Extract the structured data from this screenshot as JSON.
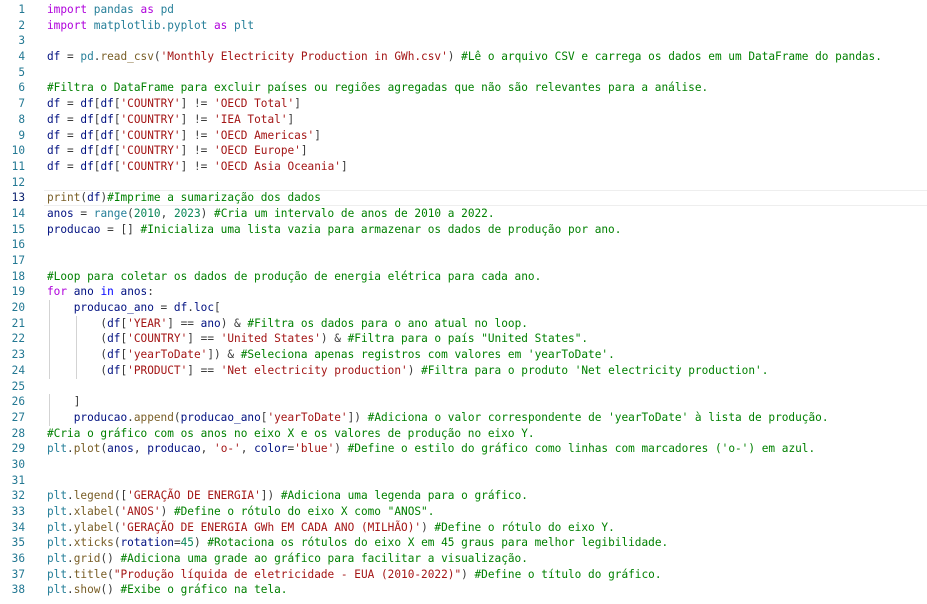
{
  "editor": {
    "language": "python",
    "current_line": 13,
    "colors": {
      "keyword": "#0000ff",
      "control": "#af00db",
      "function": "#795e26",
      "variable": "#001080",
      "string": "#a31515",
      "number": "#098658",
      "comment": "#008000",
      "line_number": "#237893"
    },
    "lines": [
      {
        "n": "1",
        "tokens": [
          [
            "ctl",
            "import"
          ],
          [
            "txt",
            " "
          ],
          [
            "mod",
            "pandas"
          ],
          [
            "txt",
            " "
          ],
          [
            "ctl",
            "as"
          ],
          [
            "txt",
            " "
          ],
          [
            "mod",
            "pd"
          ]
        ]
      },
      {
        "n": "2",
        "tokens": [
          [
            "ctl",
            "import"
          ],
          [
            "txt",
            " "
          ],
          [
            "mod",
            "matplotlib.pyplot"
          ],
          [
            "txt",
            " "
          ],
          [
            "ctl",
            "as"
          ],
          [
            "txt",
            " "
          ],
          [
            "mod",
            "plt"
          ]
        ]
      },
      {
        "n": "3",
        "tokens": []
      },
      {
        "n": "4",
        "tokens": [
          [
            "var",
            "df"
          ],
          [
            "txt",
            " = "
          ],
          [
            "mod",
            "pd"
          ],
          [
            "txt",
            "."
          ],
          [
            "fn",
            "read_csv"
          ],
          [
            "txt",
            "("
          ],
          [
            "str",
            "'Monthly Electricity Production in GWh.csv'"
          ],
          [
            "txt",
            ") "
          ],
          [
            "com",
            "#Lê o arquivo CSV e carrega os dados em um DataFrame do pandas."
          ]
        ]
      },
      {
        "n": "5",
        "tokens": []
      },
      {
        "n": "6",
        "tokens": [
          [
            "com",
            "#Filtra o DataFrame para excluir países ou regiões agregadas que não são relevantes para a análise."
          ]
        ]
      },
      {
        "n": "7",
        "tokens": [
          [
            "var",
            "df"
          ],
          [
            "txt",
            " = "
          ],
          [
            "var",
            "df"
          ],
          [
            "txt",
            "["
          ],
          [
            "var",
            "df"
          ],
          [
            "txt",
            "["
          ],
          [
            "str",
            "'COUNTRY'"
          ],
          [
            "txt",
            "] != "
          ],
          [
            "str",
            "'OECD Total'"
          ],
          [
            "txt",
            "]"
          ]
        ]
      },
      {
        "n": "8",
        "tokens": [
          [
            "var",
            "df"
          ],
          [
            "txt",
            " = "
          ],
          [
            "var",
            "df"
          ],
          [
            "txt",
            "["
          ],
          [
            "var",
            "df"
          ],
          [
            "txt",
            "["
          ],
          [
            "str",
            "'COUNTRY'"
          ],
          [
            "txt",
            "] != "
          ],
          [
            "str",
            "'IEA Total'"
          ],
          [
            "txt",
            "]"
          ]
        ]
      },
      {
        "n": "9",
        "tokens": [
          [
            "var",
            "df"
          ],
          [
            "txt",
            " = "
          ],
          [
            "var",
            "df"
          ],
          [
            "txt",
            "["
          ],
          [
            "var",
            "df"
          ],
          [
            "txt",
            "["
          ],
          [
            "str",
            "'COUNTRY'"
          ],
          [
            "txt",
            "] != "
          ],
          [
            "str",
            "'OECD Americas'"
          ],
          [
            "txt",
            "]"
          ]
        ]
      },
      {
        "n": "10",
        "tokens": [
          [
            "var",
            "df"
          ],
          [
            "txt",
            " = "
          ],
          [
            "var",
            "df"
          ],
          [
            "txt",
            "["
          ],
          [
            "var",
            "df"
          ],
          [
            "txt",
            "["
          ],
          [
            "str",
            "'COUNTRY'"
          ],
          [
            "txt",
            "] != "
          ],
          [
            "str",
            "'OECD Europe'"
          ],
          [
            "txt",
            "]"
          ]
        ]
      },
      {
        "n": "11",
        "tokens": [
          [
            "var",
            "df"
          ],
          [
            "txt",
            " = "
          ],
          [
            "var",
            "df"
          ],
          [
            "txt",
            "["
          ],
          [
            "var",
            "df"
          ],
          [
            "txt",
            "["
          ],
          [
            "str",
            "'COUNTRY'"
          ],
          [
            "txt",
            "] != "
          ],
          [
            "str",
            "'OECD Asia Oceania'"
          ],
          [
            "txt",
            "]"
          ]
        ]
      },
      {
        "n": "12",
        "tokens": []
      },
      {
        "n": "13",
        "tokens": [
          [
            "fn",
            "print"
          ],
          [
            "txt",
            "("
          ],
          [
            "var",
            "df"
          ],
          [
            "txt",
            ")"
          ],
          [
            "com",
            "#Imprime a sumarização dos dados"
          ]
        ]
      },
      {
        "n": "14",
        "tokens": [
          [
            "var",
            "anos"
          ],
          [
            "txt",
            " = "
          ],
          [
            "mod",
            "range"
          ],
          [
            "txt",
            "("
          ],
          [
            "num",
            "2010"
          ],
          [
            "txt",
            ", "
          ],
          [
            "num",
            "2023"
          ],
          [
            "txt",
            ") "
          ],
          [
            "com",
            "#Cria um intervalo de anos de 2010 a 2022."
          ]
        ]
      },
      {
        "n": "15",
        "tokens": [
          [
            "var",
            "producao"
          ],
          [
            "txt",
            " = [] "
          ],
          [
            "com",
            "#Inicializa uma lista vazia para armazenar os dados de produção por ano."
          ]
        ]
      },
      {
        "n": "16",
        "tokens": []
      },
      {
        "n": "17",
        "tokens": []
      },
      {
        "n": "18",
        "tokens": [
          [
            "com",
            "#Loop para coletar os dados de produção de energia elétrica para cada ano."
          ]
        ]
      },
      {
        "n": "19",
        "tokens": [
          [
            "ctl",
            "for"
          ],
          [
            "txt",
            " "
          ],
          [
            "var",
            "ano"
          ],
          [
            "txt",
            " "
          ],
          [
            "kw",
            "in"
          ],
          [
            "txt",
            " "
          ],
          [
            "var",
            "anos"
          ],
          [
            "txt",
            ":"
          ]
        ]
      },
      {
        "n": "20",
        "tokens": [
          [
            "txt",
            "    "
          ],
          [
            "var",
            "producao_ano"
          ],
          [
            "txt",
            " = "
          ],
          [
            "var",
            "df"
          ],
          [
            "txt",
            "."
          ],
          [
            "var",
            "loc"
          ],
          [
            "txt",
            "["
          ]
        ]
      },
      {
        "n": "21",
        "tokens": [
          [
            "txt",
            "        ("
          ],
          [
            "var",
            "df"
          ],
          [
            "txt",
            "["
          ],
          [
            "str",
            "'YEAR'"
          ],
          [
            "txt",
            "] == "
          ],
          [
            "var",
            "ano"
          ],
          [
            "txt",
            ") & "
          ],
          [
            "com",
            "#Filtra os dados para o ano atual no loop."
          ]
        ]
      },
      {
        "n": "22",
        "tokens": [
          [
            "txt",
            "        ("
          ],
          [
            "var",
            "df"
          ],
          [
            "txt",
            "["
          ],
          [
            "str",
            "'COUNTRY'"
          ],
          [
            "txt",
            "] == "
          ],
          [
            "str",
            "'United States'"
          ],
          [
            "txt",
            ") & "
          ],
          [
            "com",
            "#Filtra para o país \"United States\"."
          ]
        ]
      },
      {
        "n": "23",
        "tokens": [
          [
            "txt",
            "        ("
          ],
          [
            "var",
            "df"
          ],
          [
            "txt",
            "["
          ],
          [
            "str",
            "'yearToDate'"
          ],
          [
            "txt",
            "]) & "
          ],
          [
            "com",
            "#Seleciona apenas registros com valores em 'yearToDate'."
          ]
        ]
      },
      {
        "n": "24",
        "tokens": [
          [
            "txt",
            "        ("
          ],
          [
            "var",
            "df"
          ],
          [
            "txt",
            "["
          ],
          [
            "str",
            "'PRODUCT'"
          ],
          [
            "txt",
            "] == "
          ],
          [
            "str",
            "'Net electricity production'"
          ],
          [
            "txt",
            ") "
          ],
          [
            "com",
            "#Filtra para o produto 'Net electricity production'."
          ]
        ]
      },
      {
        "n": "25",
        "tokens": []
      },
      {
        "n": "26",
        "tokens": [
          [
            "txt",
            "    ]"
          ]
        ]
      },
      {
        "n": "27",
        "tokens": [
          [
            "txt",
            "    "
          ],
          [
            "var",
            "producao"
          ],
          [
            "txt",
            "."
          ],
          [
            "fn",
            "append"
          ],
          [
            "txt",
            "("
          ],
          [
            "var",
            "producao_ano"
          ],
          [
            "txt",
            "["
          ],
          [
            "str",
            "'yearToDate'"
          ],
          [
            "txt",
            "]) "
          ],
          [
            "com",
            "#Adiciona o valor correspondente de 'yearToDate' à lista de produção."
          ]
        ]
      },
      {
        "n": "28",
        "tokens": [
          [
            "com",
            "#Cria o gráfico com os anos no eixo X e os valores de produção no eixo Y."
          ]
        ]
      },
      {
        "n": "29",
        "tokens": [
          [
            "mod",
            "plt"
          ],
          [
            "txt",
            "."
          ],
          [
            "fn",
            "plot"
          ],
          [
            "txt",
            "("
          ],
          [
            "var",
            "anos"
          ],
          [
            "txt",
            ", "
          ],
          [
            "var",
            "producao"
          ],
          [
            "txt",
            ", "
          ],
          [
            "str",
            "'o-'"
          ],
          [
            "txt",
            ", "
          ],
          [
            "var",
            "color"
          ],
          [
            "txt",
            "="
          ],
          [
            "str",
            "'blue'"
          ],
          [
            "txt",
            ") "
          ],
          [
            "com",
            "#Define o estilo do gráfico como linhas com marcadores ('o-') em azul."
          ]
        ]
      },
      {
        "n": "30",
        "tokens": []
      },
      {
        "n": "31",
        "tokens": []
      },
      {
        "n": "32",
        "tokens": [
          [
            "mod",
            "plt"
          ],
          [
            "txt",
            "."
          ],
          [
            "fn",
            "legend"
          ],
          [
            "txt",
            "(["
          ],
          [
            "str",
            "'GERAÇÃO DE ENERGIA'"
          ],
          [
            "txt",
            "]) "
          ],
          [
            "com",
            "#Adiciona uma legenda para o gráfico."
          ]
        ]
      },
      {
        "n": "33",
        "tokens": [
          [
            "mod",
            "plt"
          ],
          [
            "txt",
            "."
          ],
          [
            "fn",
            "xlabel"
          ],
          [
            "txt",
            "("
          ],
          [
            "str",
            "'ANOS'"
          ],
          [
            "txt",
            ") "
          ],
          [
            "com",
            "#Define o rótulo do eixo X como \"ANOS\"."
          ]
        ]
      },
      {
        "n": "34",
        "tokens": [
          [
            "mod",
            "plt"
          ],
          [
            "txt",
            "."
          ],
          [
            "fn",
            "ylabel"
          ],
          [
            "txt",
            "("
          ],
          [
            "str",
            "'GERAÇÃO DE ENERGIA GWh EM CADA ANO (MILHÃO)'"
          ],
          [
            "txt",
            ") "
          ],
          [
            "com",
            "#Define o rótulo do eixo Y."
          ]
        ]
      },
      {
        "n": "35",
        "tokens": [
          [
            "mod",
            "plt"
          ],
          [
            "txt",
            "."
          ],
          [
            "fn",
            "xticks"
          ],
          [
            "txt",
            "("
          ],
          [
            "var",
            "rotation"
          ],
          [
            "txt",
            "="
          ],
          [
            "num",
            "45"
          ],
          [
            "txt",
            ") "
          ],
          [
            "com",
            "#Rotaciona os rótulos do eixo X em 45 graus para melhor legibilidade."
          ]
        ]
      },
      {
        "n": "36",
        "tokens": [
          [
            "mod",
            "plt"
          ],
          [
            "txt",
            "."
          ],
          [
            "fn",
            "grid"
          ],
          [
            "txt",
            "() "
          ],
          [
            "com",
            "#Adiciona uma grade ao gráfico para facilitar a visualização."
          ]
        ]
      },
      {
        "n": "37",
        "tokens": [
          [
            "mod",
            "plt"
          ],
          [
            "txt",
            "."
          ],
          [
            "fn",
            "title"
          ],
          [
            "txt",
            "("
          ],
          [
            "str",
            "\"Produção líquida de eletricidade - EUA (2010-2022)\""
          ],
          [
            "txt",
            ") "
          ],
          [
            "com",
            "#Define o título do gráfico."
          ]
        ]
      },
      {
        "n": "38",
        "tokens": [
          [
            "mod",
            "plt"
          ],
          [
            "txt",
            "."
          ],
          [
            "fn",
            "show"
          ],
          [
            "txt",
            "() "
          ],
          [
            "com",
            "#Exibe o gráfico na tela."
          ]
        ]
      }
    ]
  }
}
